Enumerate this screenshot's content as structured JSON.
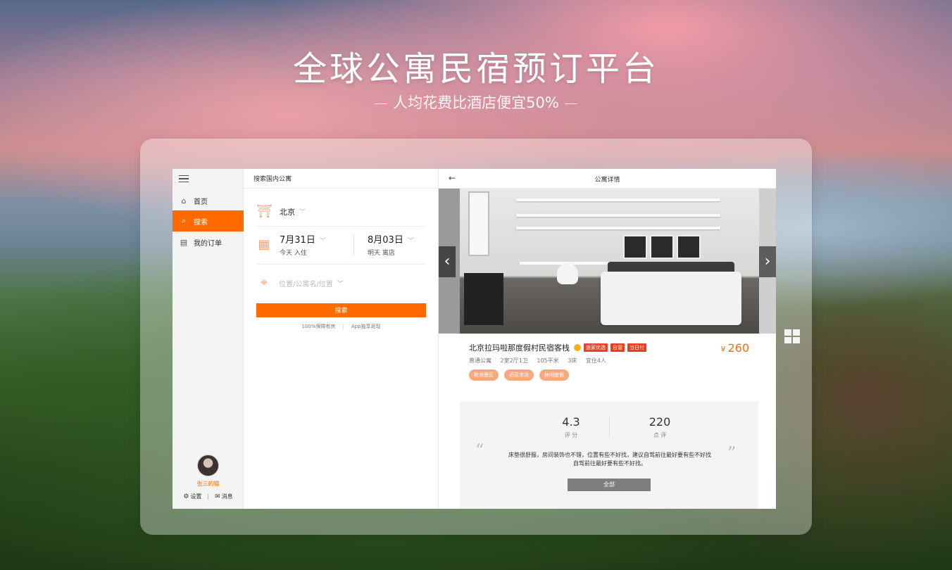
{
  "hero": {
    "title": "全球公寓民宿预订平台",
    "subtitle": "人均花费比酒店便宜50%"
  },
  "sidebar": {
    "items": [
      {
        "label": "首页",
        "icon": "home-icon"
      },
      {
        "label": "搜索",
        "icon": "search-icon",
        "active": true
      },
      {
        "label": "我的订单",
        "icon": "orders-icon"
      }
    ],
    "username": "张三的猫",
    "settings_label": "设置",
    "messages_label": "消息"
  },
  "search": {
    "header": "搜索国内公寓",
    "city": "北京",
    "checkin": {
      "date": "7月31日",
      "sub": "今天  入住"
    },
    "checkout": {
      "date": "8月03日",
      "sub": "明天  离店"
    },
    "location_placeholder": "位置/公寓名/位置",
    "search_button": "搜索",
    "tip1": "100%保障有房",
    "tip2": "App独享返现"
  },
  "detail": {
    "header": "公寓详情",
    "name": "北京拉玛啦那度假村民宿客栈",
    "badges": [
      "途家优选",
      "自营",
      "当日付"
    ],
    "price": "260",
    "currency": "¥",
    "specs": [
      "普通公寓",
      "2室2厅1卫",
      "105平米",
      "3床",
      "宜住4人"
    ],
    "tags": [
      "毗邻景区",
      "近菜市场",
      "休闲度假"
    ],
    "rating": "4.3",
    "rating_label": "评 分",
    "reviews_count": "220",
    "reviews_label": "点 评",
    "review_line1": "床垫很舒服，房间装饰也不错，位置有些不好找，建议自驾前往最好要有些不好找",
    "review_line2": "自驾前往最好要有些不好找。",
    "all_button": "全部"
  },
  "colors": {
    "accent": "#ff6a00",
    "tag": "#f6a97d",
    "badge": "#f03c1e"
  }
}
